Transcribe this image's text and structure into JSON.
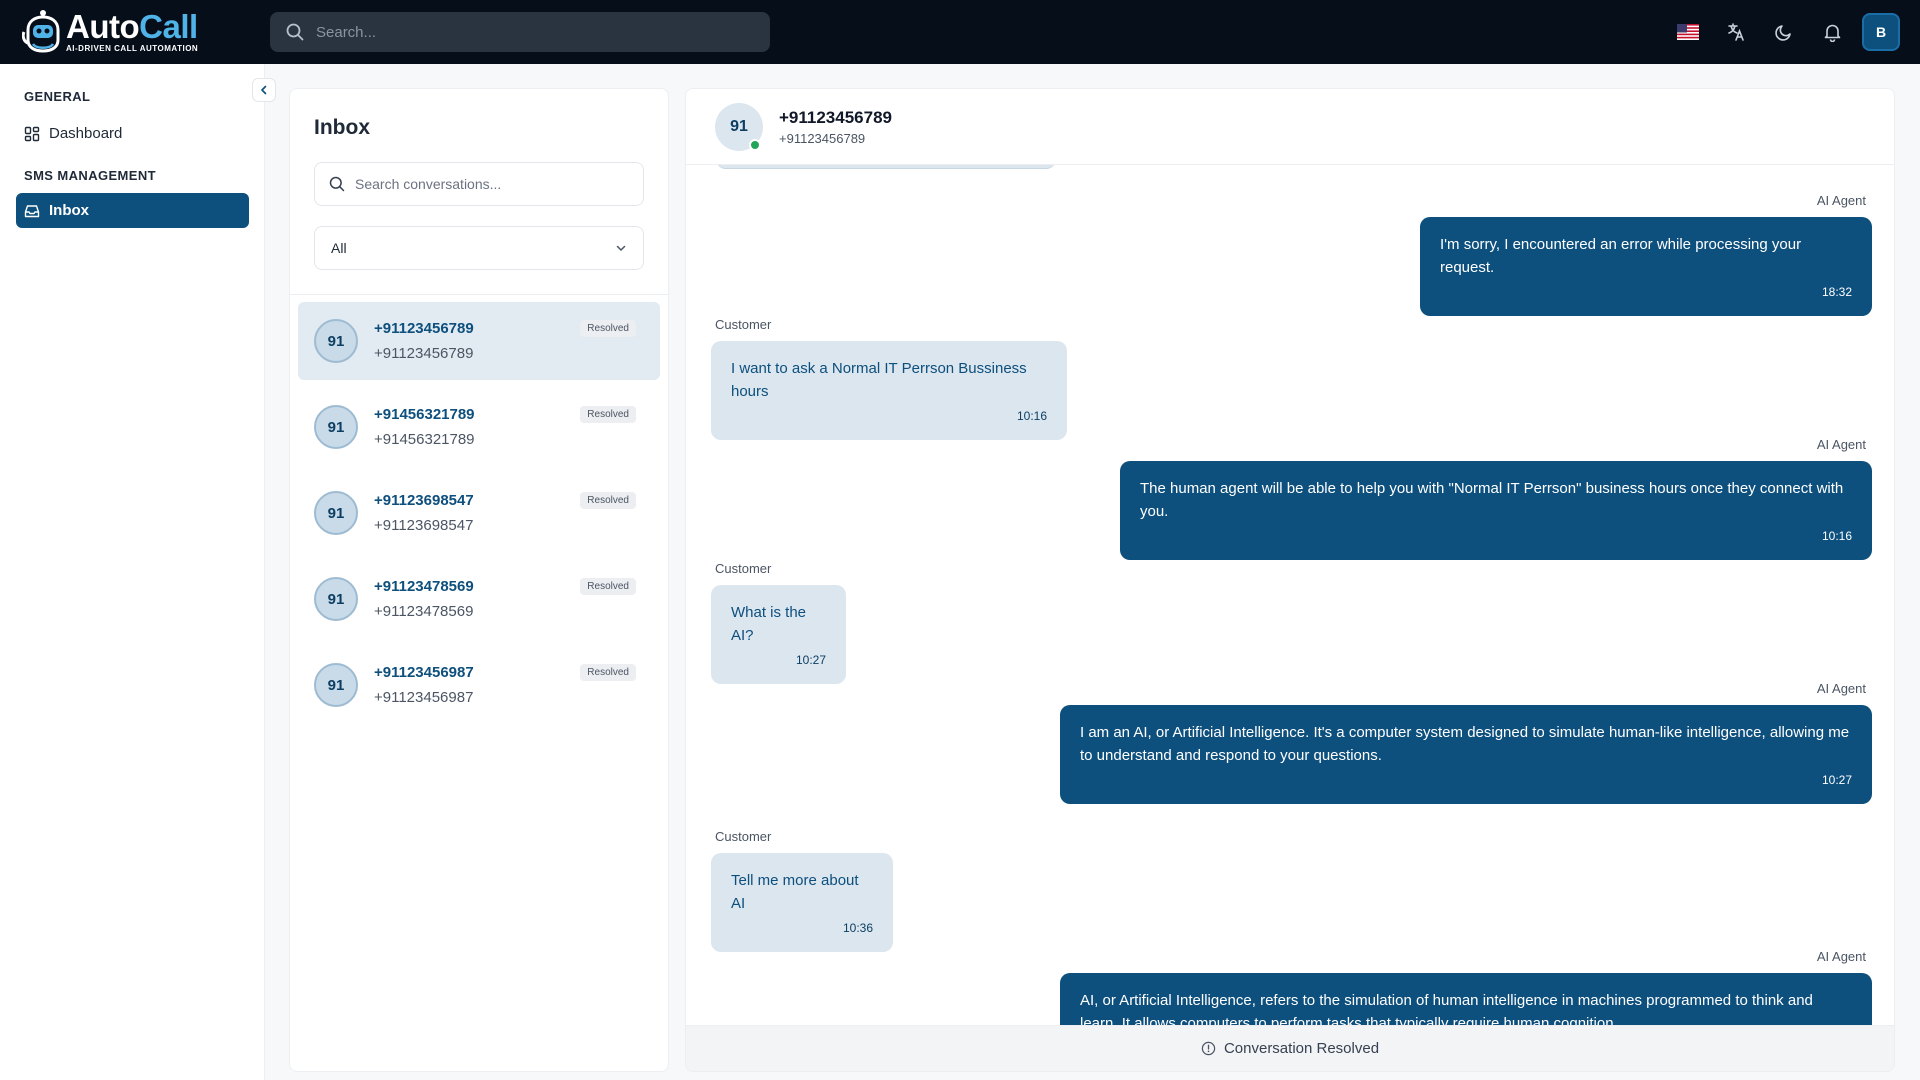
{
  "brand": {
    "name_part1": "Auto",
    "name_part2": "Call",
    "tagline": "AI-DRIVEN CALL AUTOMATION",
    "accent_color": "#4fb3e8",
    "primary_color": "#0d4f7d"
  },
  "topbar": {
    "search_placeholder": "Search...",
    "icons": [
      "us-flag-icon",
      "translate-icon",
      "moon-icon",
      "bell-icon"
    ],
    "user_initial": "B"
  },
  "sidebar": {
    "sections": [
      {
        "title": "GENERAL",
        "items": [
          {
            "label": "Dashboard",
            "icon": "dashboard-grid-icon",
            "active": false
          }
        ]
      },
      {
        "title": "SMS MANAGEMENT",
        "items": [
          {
            "label": "Inbox",
            "icon": "inbox-icon",
            "active": true
          }
        ]
      }
    ]
  },
  "inbox": {
    "title": "Inbox",
    "search_placeholder": "Search conversations...",
    "filter_value": "All",
    "conversations": [
      {
        "avatar": "91",
        "name": "+91123456789",
        "number": "+91123456789",
        "status": "Resolved",
        "active": true
      },
      {
        "avatar": "91",
        "name": "+91456321789",
        "number": "+91456321789",
        "status": "Resolved",
        "active": false
      },
      {
        "avatar": "91",
        "name": "+91123698547",
        "number": "+91123698547",
        "status": "Resolved",
        "active": false
      },
      {
        "avatar": "91",
        "name": "+91123478569",
        "number": "+91123478569",
        "status": "Resolved",
        "active": false
      },
      {
        "avatar": "91",
        "name": "+91123456987",
        "number": "+91123456987",
        "status": "Resolved",
        "active": false
      }
    ]
  },
  "chat": {
    "avatar": "91",
    "name": "+91123456789",
    "number": "+91123456789",
    "online_color": "#22a55a",
    "messages": [
      {
        "sender": "AI Agent",
        "text": "I'm sorry, I encountered an error while processing your request.",
        "time": "18:32"
      },
      {
        "sender": "Customer",
        "text": "I want to ask a Normal IT Perrson Bussiness hours",
        "time": "10:16"
      },
      {
        "sender": "AI Agent",
        "text": "The human agent will be able to help you with \"Normal IT Perrson\" business hours once they connect with you.",
        "time": "10:16"
      },
      {
        "sender": "Customer",
        "text": "What is the AI?",
        "time": "10:27"
      },
      {
        "sender": "AI Agent",
        "text": "I am an AI, or Artificial Intelligence. It's a computer system designed to simulate human-like intelligence, allowing me to understand and respond to your questions.",
        "time": "10:27"
      },
      {
        "sender": "Customer",
        "text": "Tell me more about AI",
        "time": "10:36"
      },
      {
        "sender": "AI Agent",
        "text": "AI, or Artificial Intelligence, refers to the simulation of human intelligence in machines programmed to think and learn. It allows computers to perform tasks that typically require human cognition",
        "time": ""
      }
    ],
    "footer_status": "Conversation Resolved"
  }
}
